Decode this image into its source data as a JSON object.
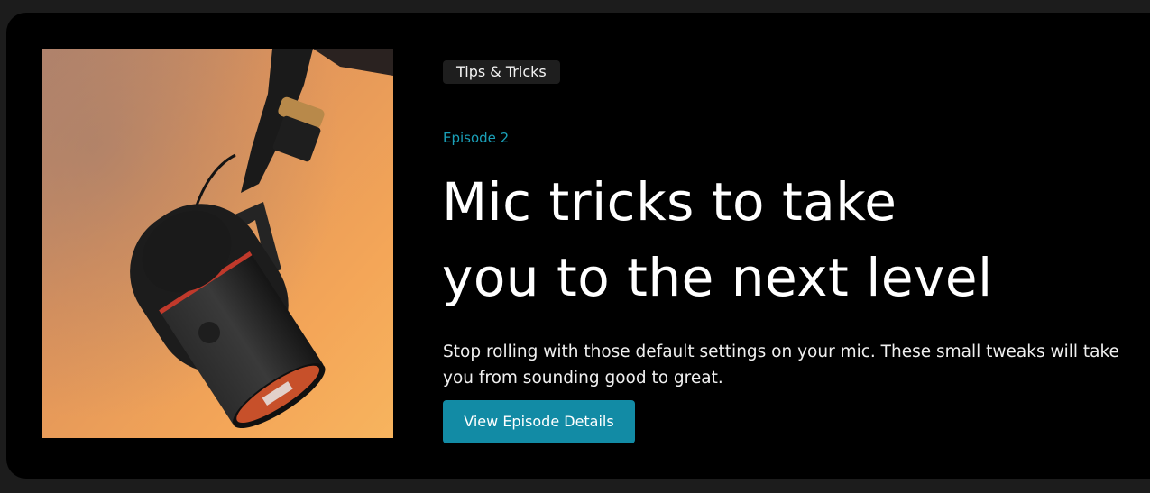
{
  "episode_card": {
    "tag": "Tips & Tricks",
    "episode_label": "Episode 2",
    "title_line1": "Mic tricks to take",
    "title_line2": "you to the next level",
    "description": "Stop rolling with those default settings on your mic. These small tweaks will take you from sounding good to great.",
    "cta_label": "View Episode Details",
    "cover_image": "microphone-photo"
  },
  "colors": {
    "page_background": "#1c1c1c",
    "card_background": "#000000",
    "accent": "#128ba5",
    "episode_text": "#1aa0b8",
    "tag_background": "#1e1e1e",
    "text": "#ffffff"
  }
}
